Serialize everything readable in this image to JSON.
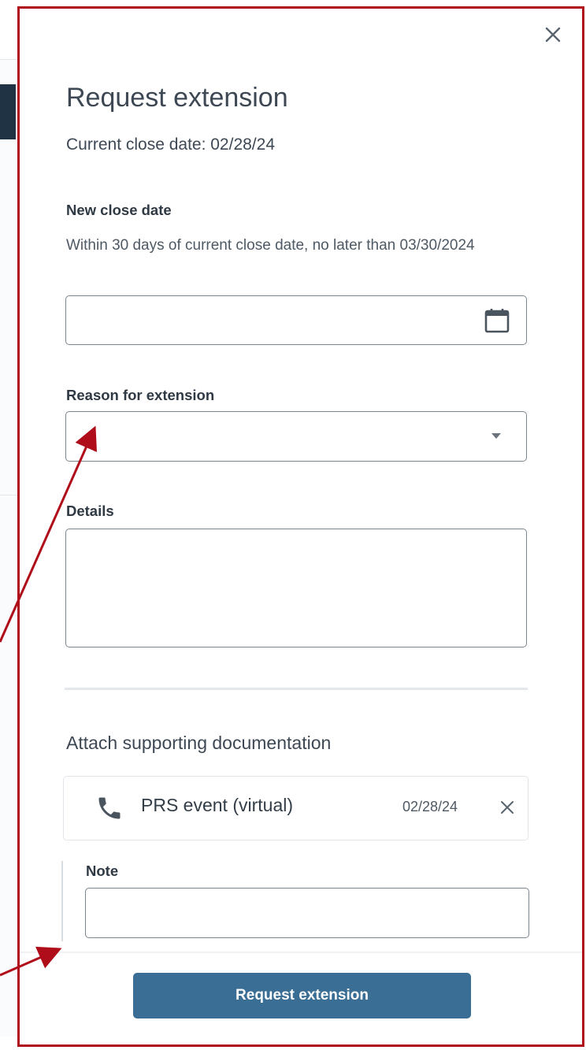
{
  "drawer": {
    "title": "Request extension",
    "current_close_date": "Current close date: 02/28/24"
  },
  "form": {
    "new_close_date_label": "New close date",
    "new_close_date_hint": "Within 30 days of current close date, no later than 03/30/2024",
    "new_close_date_value": "",
    "reason_label": "Reason for extension",
    "reason_value": "",
    "details_label": "Details",
    "details_value": ""
  },
  "attachments": {
    "section_title": "Attach supporting documentation",
    "items": [
      {
        "icon": "phone-icon",
        "name": "PRS event (virtual)",
        "date": "02/28/24"
      }
    ],
    "note_label": "Note",
    "note_value": ""
  },
  "footer": {
    "submit_label": "Request extension"
  },
  "colors": {
    "annotation_border": "#b00d1a",
    "primary_button": "#3a6e94",
    "text": "#333d47"
  }
}
